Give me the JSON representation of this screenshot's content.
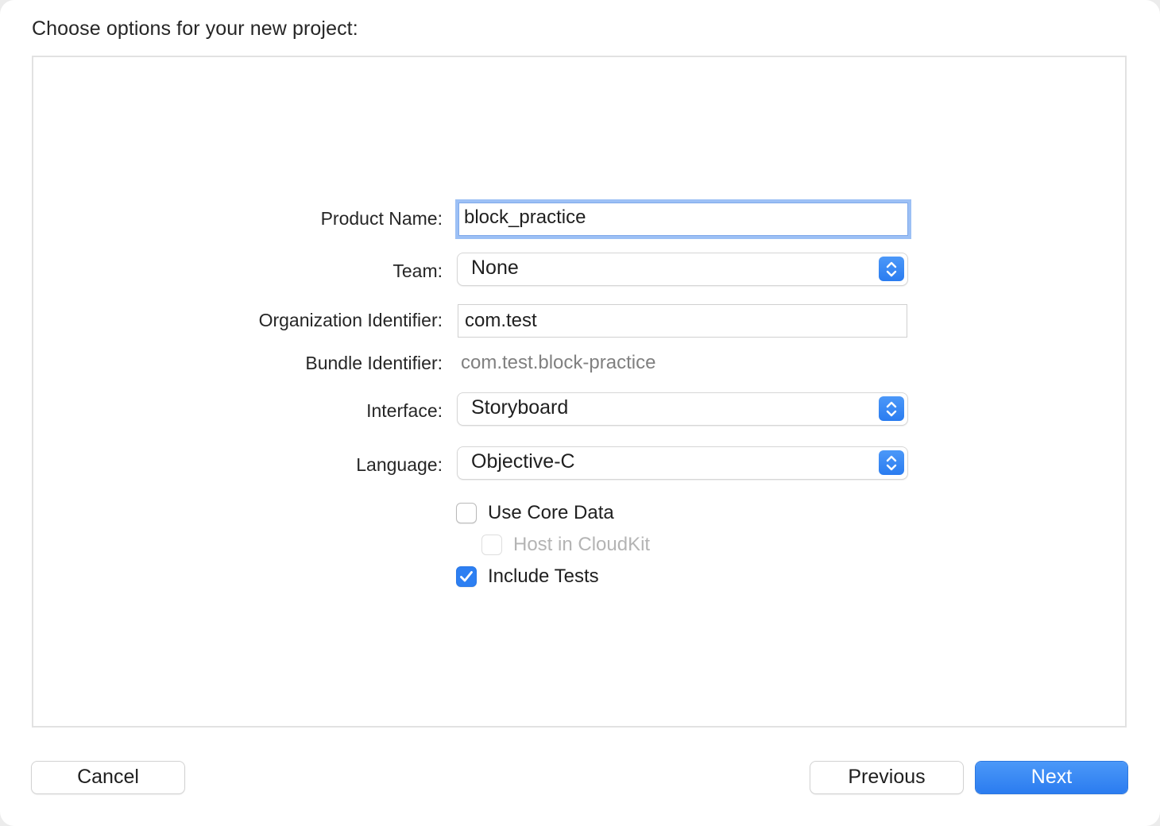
{
  "dialog": {
    "title": "Choose options for your new project:"
  },
  "form": {
    "product_name": {
      "label": "Product Name:",
      "value": "block_practice"
    },
    "team": {
      "label": "Team:",
      "value": "None"
    },
    "organization_identifier": {
      "label": "Organization Identifier:",
      "value": "com.test"
    },
    "bundle_identifier": {
      "label": "Bundle Identifier:",
      "value": "com.test.block-practice"
    },
    "interface": {
      "label": "Interface:",
      "value": "Storyboard"
    },
    "language": {
      "label": "Language:",
      "value": "Objective-C"
    },
    "checkboxes": [
      {
        "label": "Use Core Data",
        "checked": false,
        "enabled": true
      },
      {
        "label": "Host in CloudKit",
        "checked": false,
        "enabled": false
      },
      {
        "label": "Include Tests",
        "checked": true,
        "enabled": true
      }
    ]
  },
  "buttons": {
    "cancel": "Cancel",
    "previous": "Previous",
    "next": "Next"
  },
  "colors": {
    "accent": "#2d7ff2",
    "focus_ring": "#9cc0f5",
    "disabled_text": "#b4b4b4"
  },
  "icons": {
    "popup_arrows": "up-down-chevron-icon",
    "checkmark": "checkmark-icon"
  }
}
